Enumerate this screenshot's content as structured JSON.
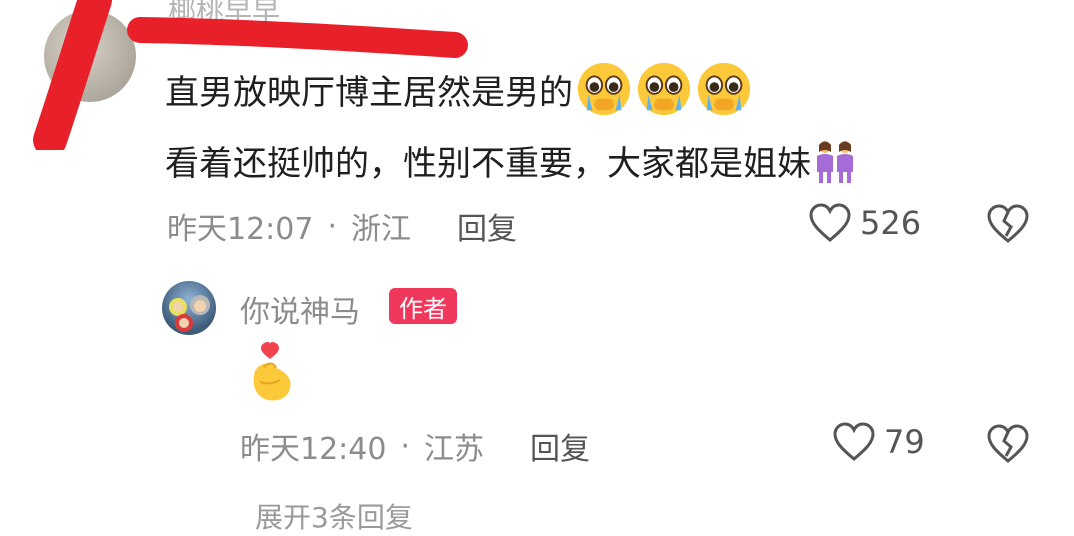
{
  "comment": {
    "username": "椰桃早早",
    "line1": "直男放映厅博主居然是男的",
    "line1_emojis": [
      "pleading-crying-face-icon",
      "pleading-crying-face-icon",
      "pleading-crying-face-icon"
    ],
    "line2": "看着还挺帅的，性别不重要，大家都是姐妹",
    "line2_emoji": "two-women-icon",
    "time": "昨天12:07",
    "separator": "·",
    "location": "浙江",
    "reply_label": "回复",
    "likes": "526"
  },
  "reply": {
    "username": "你说神马",
    "badge": "作者",
    "content_emoji": "finger-heart-icon",
    "time": "昨天12:40",
    "separator": "·",
    "location": "江苏",
    "reply_label": "回复",
    "likes": "79"
  },
  "more_replies": "展开3条回复",
  "colors": {
    "badge": "#f0385c",
    "redmark": "#e8202a",
    "meta": "#8c8c8c"
  }
}
